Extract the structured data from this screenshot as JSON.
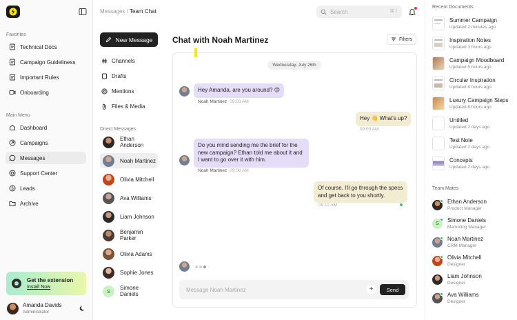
{
  "sidebar": {
    "favorites_title": "Favorites",
    "favorites": [
      {
        "label": "Technical Docs",
        "icon": "doc-icon"
      },
      {
        "label": "Campaign Guideliness",
        "icon": "doc-icon"
      },
      {
        "label": "Important Rules",
        "icon": "doc-icon"
      },
      {
        "label": "Onboarding",
        "icon": "video-icon"
      }
    ],
    "main_menu_title": "Main Menu",
    "menu": [
      {
        "label": "Dashboard",
        "icon": "dashboard-icon"
      },
      {
        "label": "Campaigns",
        "icon": "campaign-icon"
      },
      {
        "label": "Messages",
        "icon": "message-icon",
        "active": true
      },
      {
        "label": "Support Center",
        "icon": "support-icon"
      },
      {
        "label": "Leads",
        "icon": "dollar-icon"
      },
      {
        "label": "Archive",
        "icon": "folder-icon"
      }
    ],
    "promo": {
      "title": "Get the extension",
      "link": "Install Now"
    },
    "user": {
      "name": "Amanda Davids",
      "role": "Administrator"
    }
  },
  "topbar": {
    "breadcrumb_parent": "Messages",
    "breadcrumb_sep": "/",
    "breadcrumb_current": "Team Chat",
    "search_placeholder": "Search",
    "search_shortcut": "⌘ /"
  },
  "channels": {
    "new_message": "New Message",
    "items": [
      {
        "label": "Channels",
        "icon": "hash-icon"
      },
      {
        "label": "Drafts",
        "icon": "draft-icon"
      },
      {
        "label": "Mentions",
        "icon": "at-icon"
      },
      {
        "label": "Files & Media",
        "icon": "paperclip-icon"
      }
    ],
    "dm_title": "Direct Messages",
    "dms": [
      {
        "name": "Ethan Anderson"
      },
      {
        "name": "Noah Martinez",
        "active": true
      },
      {
        "name": "Olivia Mitchell"
      },
      {
        "name": "Ava Williams"
      },
      {
        "name": "Liam Johnson"
      },
      {
        "name": "Benjamin Parker"
      },
      {
        "name": "Olivia Adams"
      },
      {
        "name": "Sophie Jones"
      },
      {
        "name": "Simone Daniels",
        "initial": "S"
      }
    ]
  },
  "chat": {
    "title": "Chat with Noah Martinez",
    "filters": "Filters",
    "date": "Wednesday, July 26th",
    "messages": [
      {
        "dir": "in",
        "text": "Hey Amanda, are you around? 😊",
        "author": "Noah Martinez",
        "time": "09:03 AM"
      },
      {
        "dir": "out",
        "text": "Hey 👋 What's up?",
        "time": "09:03 AM"
      },
      {
        "dir": "in",
        "text": "Do you mind sending me the brief for the new campaign? Ethan told me about it and I want to go over it with him.",
        "author": "Noah Martinez",
        "time": "09:08 AM"
      },
      {
        "dir": "out",
        "text": "Of course. I'll go through the specs and get back to you shortly.",
        "time": "09:11 AM"
      }
    ],
    "composer_placeholder": "Message Noah Martinez",
    "send": "Send"
  },
  "right": {
    "docs_title": "Recent Documents",
    "docs": [
      {
        "name": "Summer Campaign",
        "sub": "Updated 2 minutes ago"
      },
      {
        "name": "Inspiration Notes",
        "sub": "Updated 3 hours ago"
      },
      {
        "name": "Campaign Moodboard",
        "sub": "Updated 5 hours ago"
      },
      {
        "name": "Circular Inspiration",
        "sub": "Updated 8 hours ago"
      },
      {
        "name": "Luxury Campaign Steps",
        "sub": "Updated 8 hours ago"
      },
      {
        "name": "Untitled",
        "sub": "Updated 2 days ago"
      },
      {
        "name": "Test Note",
        "sub": "Updated 2 days ago"
      },
      {
        "name": "Concepts",
        "sub": "Updated 2 days ago"
      }
    ],
    "mates_title": "Team Mates",
    "mates": [
      {
        "name": "Ethan Anderson",
        "role": "Product Manager"
      },
      {
        "name": "Simone Daniels",
        "role": "Marketing Manager",
        "initial": "S"
      },
      {
        "name": "Noah Martinez",
        "role": "CRM Manager"
      },
      {
        "name": "Olivia Mitchell",
        "role": "Designer"
      },
      {
        "name": "Liam Johnson",
        "role": "Designer"
      },
      {
        "name": "Ava Williams",
        "role": "Designer"
      }
    ]
  },
  "colors": {
    "accent": "#222222",
    "incoming": "#e5dcf7",
    "outgoing": "#f3ecd3",
    "online": "#3ac36b"
  }
}
